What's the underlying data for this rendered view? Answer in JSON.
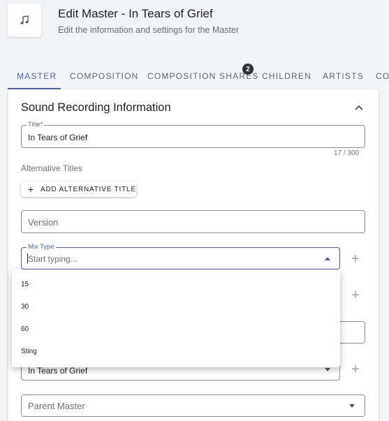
{
  "header": {
    "title": "Edit Master - In Tears of Grief",
    "subtitle": "Edit the information and settings for the Master",
    "icon": "music-note-icon"
  },
  "tabs": [
    {
      "label": "MASTER",
      "active": true
    },
    {
      "label": "COMPOSITION"
    },
    {
      "label": "COMPOSITION SHARES",
      "badge": "2"
    },
    {
      "label": "CHILDREN"
    },
    {
      "label": "ARTISTS"
    },
    {
      "label": "CO"
    }
  ],
  "section": {
    "title": "Sound Recording Information"
  },
  "form": {
    "title_label": "Title",
    "title_required": "*",
    "title_value": "In Tears of Grief",
    "title_counter": "17 / 300",
    "alt_titles_label": "Alternative Titles",
    "add_alt_title_button": "ADD ALTERNATIVE TITLE",
    "version_placeholder": "Version",
    "mix_type_label": "Mix Type",
    "mix_type_placeholder": "Start typing...",
    "partial_select_value": "In Tears of Grief",
    "parent_master_placeholder": "Parent Master"
  },
  "mix_type_options": [
    "15",
    "30",
    "60",
    "Sting"
  ],
  "colors": {
    "accent": "#4a5fb5",
    "badge": "#2f3033",
    "required": "#d32f2f"
  }
}
